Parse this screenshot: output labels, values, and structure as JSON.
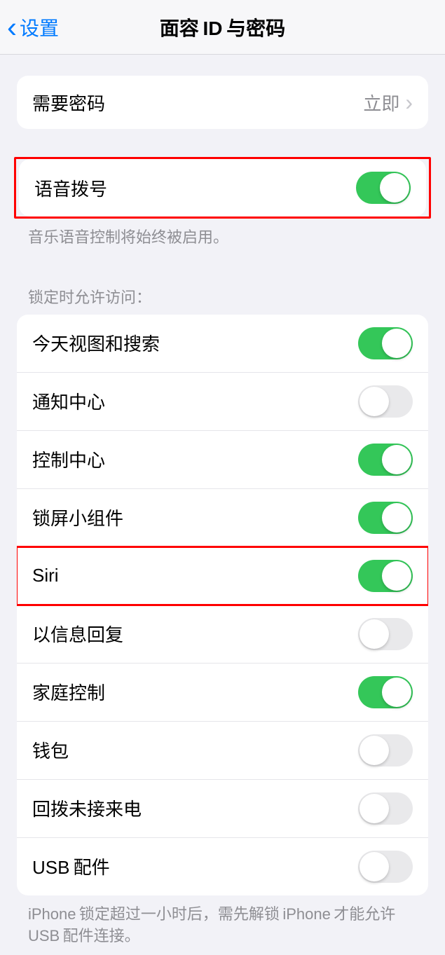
{
  "header": {
    "back_label": "设置",
    "title": "面容 ID 与密码"
  },
  "passcode_section": {
    "label": "需要密码",
    "value": "立即"
  },
  "voice_dial": {
    "label": "语音拨号",
    "enabled": true,
    "footer": "音乐语音控制将始终被启用。"
  },
  "lock_access": {
    "header": "锁定时允许访问：",
    "items": [
      {
        "label": "今天视图和搜索",
        "enabled": true
      },
      {
        "label": "通知中心",
        "enabled": false
      },
      {
        "label": "控制中心",
        "enabled": true
      },
      {
        "label": "锁屏小组件",
        "enabled": true
      },
      {
        "label": "Siri",
        "enabled": true
      },
      {
        "label": "以信息回复",
        "enabled": false
      },
      {
        "label": "家庭控制",
        "enabled": true
      },
      {
        "label": "钱包",
        "enabled": false
      },
      {
        "label": "回拨未接来电",
        "enabled": false
      },
      {
        "label": "USB 配件",
        "enabled": false
      }
    ],
    "footer": "iPhone 锁定超过一小时后，需先解锁 iPhone 才能允许USB 配件连接。"
  }
}
